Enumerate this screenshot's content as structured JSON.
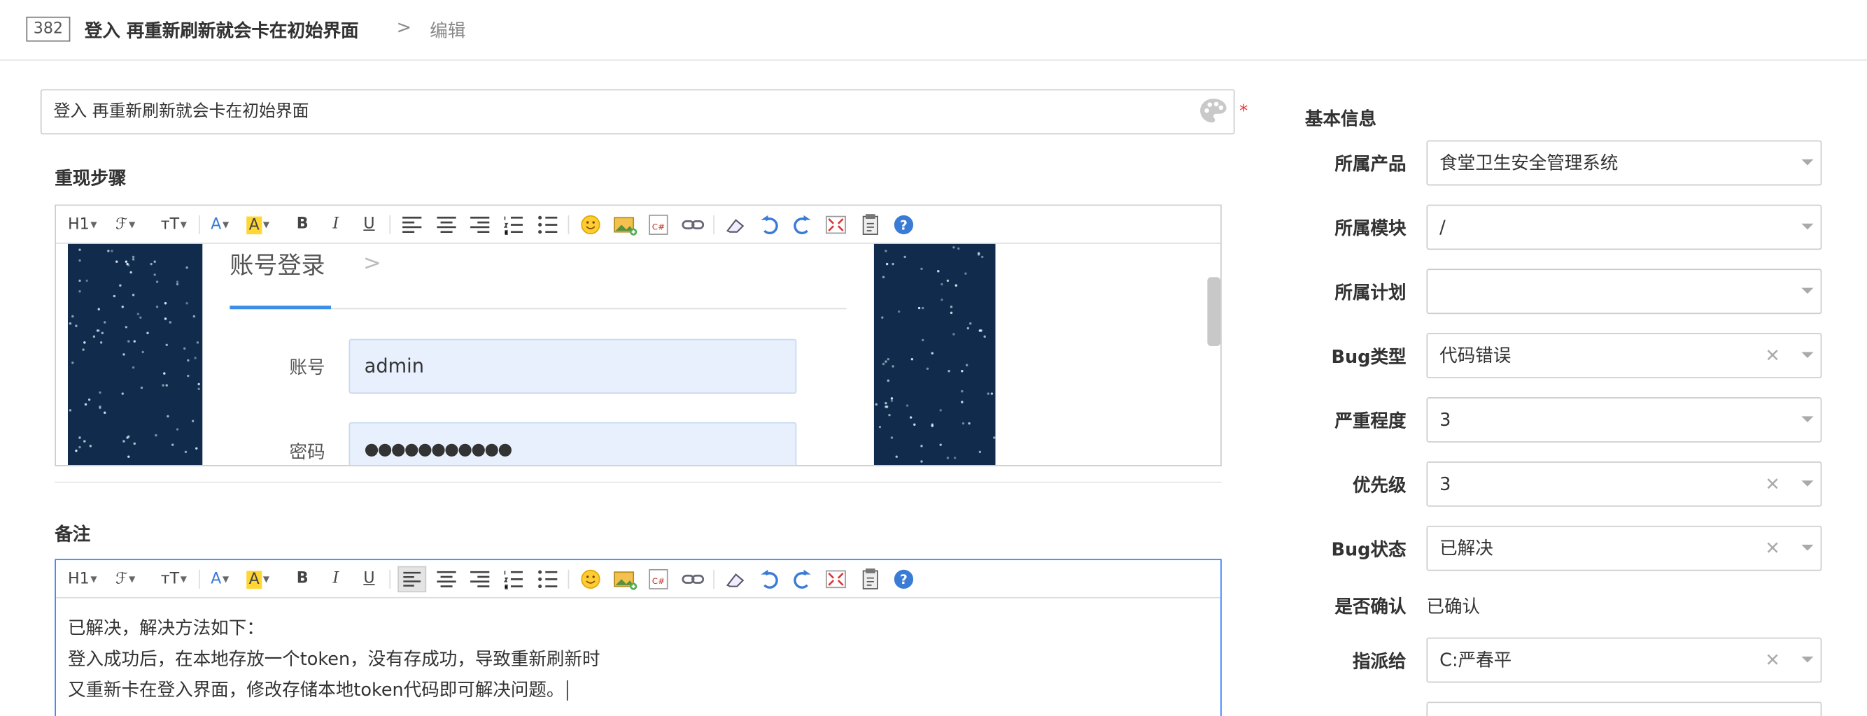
{
  "header": {
    "id": "382",
    "title": "登入 再重新刷新就会卡在初始界面",
    "separator": ">",
    "action": "编辑"
  },
  "title_input": {
    "value": "登入 再重新刷新就会卡在初始界面",
    "required_mark": "*"
  },
  "steps": {
    "label": "重现步骤",
    "embedded_login": {
      "title": "账号登录",
      "arrow": ">",
      "account_label": "账号",
      "account_value": "admin",
      "password_label": "密码",
      "password_value": "●●●●●●●●●●●"
    }
  },
  "toolbar": {
    "heading": "H1",
    "font": "ℱ",
    "size": "тT",
    "font_color": "A",
    "bg_color": "A",
    "bold": "B",
    "italic": "I",
    "underline": "U"
  },
  "notes": {
    "label": "备注",
    "lines": [
      "已解决，解决方法如下：",
      "登入成功后，在本地存放一个token，没有存成功，导致重新刷新时",
      "又重新卡在登入界面，修改存储本地token代码即可解决问题。"
    ]
  },
  "sidebar": {
    "title": "基本信息",
    "fields": [
      {
        "label": "所属产品",
        "value": "食堂卫生安全管理系统",
        "clearable": false
      },
      {
        "label": "所属模块",
        "value": "/",
        "clearable": false
      },
      {
        "label": "所属计划",
        "value": "",
        "clearable": false
      },
      {
        "label": "Bug类型",
        "value": "代码错误",
        "clearable": true
      },
      {
        "label": "严重程度",
        "value": "3",
        "clearable": false
      },
      {
        "label": "优先级",
        "value": "3",
        "clearable": true
      },
      {
        "label": "Bug状态",
        "value": "已解决",
        "clearable": true
      }
    ],
    "confirm": {
      "label": "是否确认",
      "value": "已确认"
    },
    "assign": {
      "label": "指派给",
      "value": "C:严春平",
      "clearable": true
    },
    "clear_glyph": "✕"
  },
  "colors": {
    "accent": "#3280fc",
    "required": "#ee3333",
    "sky": "#112b4d",
    "input_fill": "#e8f0fd"
  }
}
